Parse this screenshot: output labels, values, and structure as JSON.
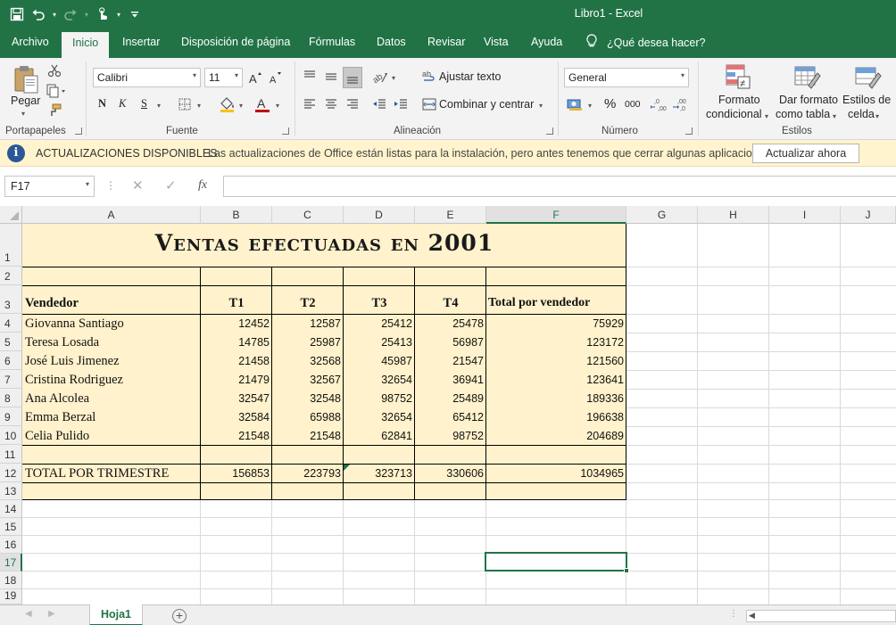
{
  "window": {
    "title": "Libro1  -  Excel",
    "colors": {
      "brand": "#217346",
      "table_fill": "#fff2cc",
      "info_bar": "#fff4ce"
    }
  },
  "qat": {
    "icons": [
      "save-icon",
      "undo-icon",
      "redo-icon",
      "touch-mode-icon",
      "customize-qat-icon"
    ]
  },
  "tabs": [
    "Archivo",
    "Inicio",
    "Insertar",
    "Disposición de página",
    "Fórmulas",
    "Datos",
    "Revisar",
    "Vista",
    "Ayuda"
  ],
  "active_tab": "Inicio",
  "tell_me": "¿Qué desea hacer?",
  "ribbon": {
    "groups": {
      "clipboard": "Portapapeles",
      "font": "Fuente",
      "alignment": "Alineación",
      "number": "Número",
      "styles": "Estilos"
    },
    "paste_label": "Pegar",
    "font_name": "Calibri",
    "font_size": "11",
    "bold": "N",
    "italic": "K",
    "underline": "S",
    "wrap_text": "Ajustar texto",
    "merge_center": "Combinar y centrar",
    "number_format": "General",
    "percent": "%",
    "thousands": "000",
    "cond_format_1": "Formato",
    "cond_format_2": "condicional",
    "table_format_1": "Dar formato",
    "table_format_2": "como tabla",
    "cell_styles_1": "Estilos de",
    "cell_styles_2": "celda"
  },
  "infobar": {
    "title": "ACTUALIZACIONES DISPONIBLES",
    "message": "Las actualizaciones de Office están listas para la instalación, pero antes tenemos que cerrar algunas aplicaciones.",
    "button": "Actualizar ahora"
  },
  "formula_bar": {
    "name_box": "F17",
    "fx": "fx",
    "content": ""
  },
  "columns": [
    "A",
    "B",
    "C",
    "D",
    "E",
    "F",
    "G",
    "H",
    "I",
    "J"
  ],
  "selected_column": "F",
  "rows": [
    "1",
    "2",
    "3",
    "4",
    "5",
    "6",
    "7",
    "8",
    "9",
    "10",
    "11",
    "12",
    "13",
    "14",
    "15",
    "16",
    "17",
    "18",
    "19"
  ],
  "selected_row": "17",
  "sheet": {
    "title": "Ventas efectuadas en 2001",
    "headers": [
      "Vendedor",
      "T1",
      "T2",
      "T3",
      "T4",
      "Total por vendedor"
    ],
    "data_rows": [
      [
        "Giovanna Santiago",
        "12452",
        "12587",
        "25412",
        "25478",
        "75929"
      ],
      [
        "Teresa Losada",
        "14785",
        "25987",
        "25413",
        "56987",
        "123172"
      ],
      [
        "José Luis Jimenez",
        "21458",
        "32568",
        "45987",
        "21547",
        "121560"
      ],
      [
        "Cristina Rodriguez",
        "21479",
        "32567",
        "32654",
        "36941",
        "123641"
      ],
      [
        "Ana Alcolea",
        "32547",
        "32548",
        "98752",
        "25489",
        "189336"
      ],
      [
        "Emma Berzal",
        "32584",
        "65988",
        "32654",
        "65412",
        "196638"
      ],
      [
        "Celia Pulido",
        "21548",
        "21548",
        "62841",
        "98752",
        "204689"
      ]
    ],
    "total_row": [
      "TOTAL POR TRIMESTRE",
      "156853",
      "223793",
      "323713",
      "330606",
      "1034965"
    ]
  },
  "sheet_tabs": {
    "active": "Hoja1",
    "add": "+"
  }
}
